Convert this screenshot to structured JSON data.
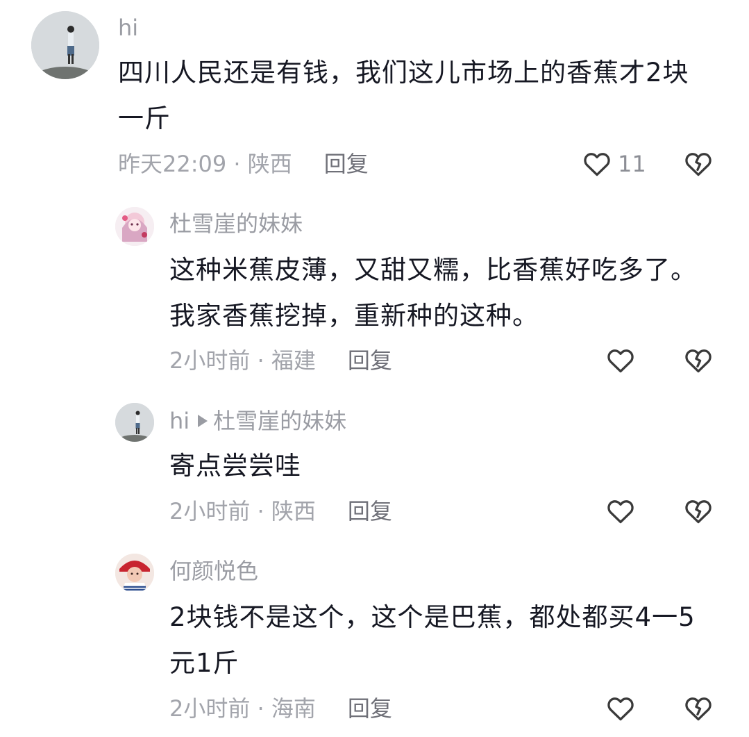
{
  "comments": [
    {
      "username": "hi",
      "text": "四川人民还是有钱，我们这儿市场上的香蕉才2块一斤",
      "time": "昨天22:09",
      "location": "陕西",
      "reply_label": "回复",
      "likes": "11",
      "avatar_icon": "person-standing-on-rock-avatar"
    }
  ],
  "replies": [
    {
      "username": "杜雪崖的妹妹",
      "text": "这种米蕉皮薄，又甜又糯，比香蕉好吃多了。我家香蕉挖掉，重新种的这种。",
      "time": "2小时前",
      "location": "福建",
      "reply_label": "回复",
      "avatar_icon": "anime-girl-avatar"
    },
    {
      "username": "hi",
      "reply_to": "杜雪崖的妹妹",
      "text": "寄点尝尝哇",
      "time": "2小时前",
      "location": "陕西",
      "reply_label": "回复",
      "avatar_icon": "person-standing-on-rock-avatar"
    },
    {
      "username": "何颜悦色",
      "text": "2块钱不是这个，这个是巴蕉，都处都买4一5元1斤",
      "time": "2小时前",
      "location": "海南",
      "reply_label": "回复",
      "avatar_icon": "red-hat-person-avatar"
    }
  ],
  "separator": " · ",
  "icons": {
    "like": "heart-outline-icon",
    "dislike": "broken-heart-icon"
  },
  "colors": {
    "text": "#161823",
    "secondary": "#a2a4ab",
    "icon": "#3a3a3a"
  }
}
